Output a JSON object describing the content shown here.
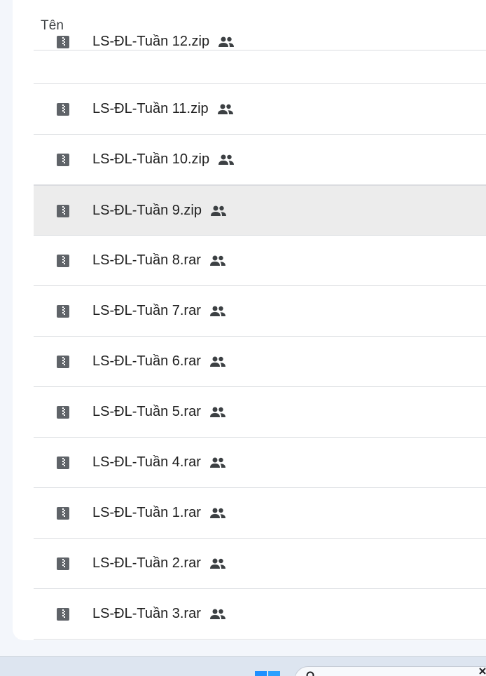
{
  "header": {
    "name_column_label": "Tên"
  },
  "files": [
    {
      "name": "LS-ĐL-Tuần 12.zip",
      "icon": "archive-file-icon",
      "shared_icon": "shared-people-icon"
    },
    {
      "name": "LS-ĐL-Tuần 11.zip",
      "icon": "archive-file-icon",
      "shared_icon": "shared-people-icon"
    },
    {
      "name": "LS-ĐL-Tuần 10.zip",
      "icon": "archive-file-icon",
      "shared_icon": "shared-people-icon"
    },
    {
      "name": "LS-ĐL-Tuần 9.zip",
      "icon": "archive-file-icon",
      "shared_icon": "shared-people-icon",
      "selected": true
    },
    {
      "name": "LS-ĐL-Tuần 8.rar",
      "icon": "archive-file-icon",
      "shared_icon": "shared-people-icon"
    },
    {
      "name": "LS-ĐL-Tuần 7.rar",
      "icon": "archive-file-icon",
      "shared_icon": "shared-people-icon"
    },
    {
      "name": "LS-ĐL-Tuần 6.rar",
      "icon": "archive-file-icon",
      "shared_icon": "shared-people-icon"
    },
    {
      "name": "LS-ĐL-Tuần 5.rar",
      "icon": "archive-file-icon",
      "shared_icon": "shared-people-icon"
    },
    {
      "name": "LS-ĐL-Tuần 4.rar",
      "icon": "archive-file-icon",
      "shared_icon": "shared-people-icon"
    },
    {
      "name": "LS-ĐL-Tuần 1.rar",
      "icon": "archive-file-icon",
      "shared_icon": "shared-people-icon"
    },
    {
      "name": "LS-ĐL-Tuần 2.rar",
      "icon": "archive-file-icon",
      "shared_icon": "shared-people-icon"
    },
    {
      "name": "LS-ĐL-Tuần 3.rar",
      "icon": "archive-file-icon",
      "shared_icon": "shared-people-icon"
    }
  ],
  "taskbar": {
    "start_icon": "windows-start-icon",
    "search_icon": "search-icon"
  },
  "colors": {
    "selected_row": "#ececec",
    "icon_gray": "#5f6368",
    "divider": "#dadce0",
    "text": "#1f1f1f",
    "windows_blue": "#1e90ff"
  }
}
